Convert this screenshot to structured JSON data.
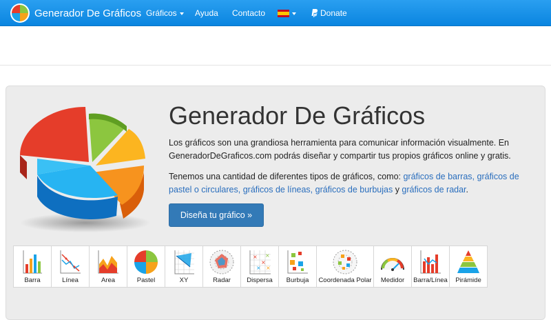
{
  "navbar": {
    "brand": "Generador De Gráficos",
    "items": {
      "graficos": "Gráficos",
      "ayuda": "Ayuda",
      "contacto": "Contacto",
      "donate": "Donate"
    },
    "background": "#1a93e8"
  },
  "hero": {
    "title": "Generador De Gráficos",
    "p1": "Los gráficos son una grandiosa herramienta para comunicar información visualmente. En GeneradorDeGraficos.com podrás diseñar y compartir tus propios gráficos online y gratis.",
    "p2": {
      "intro": "Tenemos una cantidad de diferentes tipos de gráficos, como: ",
      "link_barras": "gráficos de barras,",
      "link_pastel": "gráficos de pastel o circulares,",
      "link_lineas": "gráficos de líneas,",
      "link_burbujas": "gráficos de burbujas",
      "and": " y ",
      "link_radar": "gráficos de radar",
      "end": "."
    },
    "cta": "Diseña tu gráfico »",
    "link_color": "#2a6ebd",
    "button_color": "#337ab7"
  },
  "chart_types": [
    {
      "label": "Barra",
      "icon": "bar-chart-icon"
    },
    {
      "label": "Línea",
      "icon": "line-chart-icon"
    },
    {
      "label": "Area",
      "icon": "area-chart-icon"
    },
    {
      "label": "Pastel",
      "icon": "pie-chart-icon"
    },
    {
      "label": "XY",
      "icon": "xy-chart-icon"
    },
    {
      "label": "Radar",
      "icon": "radar-chart-icon"
    },
    {
      "label": "Dispersa",
      "icon": "scatter-chart-icon"
    },
    {
      "label": "Burbuja",
      "icon": "bubble-chart-icon"
    },
    {
      "label": "Coordenada Polar",
      "icon": "polar-chart-icon"
    },
    {
      "label": "Medidor",
      "icon": "gauge-chart-icon"
    },
    {
      "label": "Barra/Línea",
      "icon": "bar-line-chart-icon"
    },
    {
      "label": "Pirámide",
      "icon": "pyramid-chart-icon"
    }
  ]
}
